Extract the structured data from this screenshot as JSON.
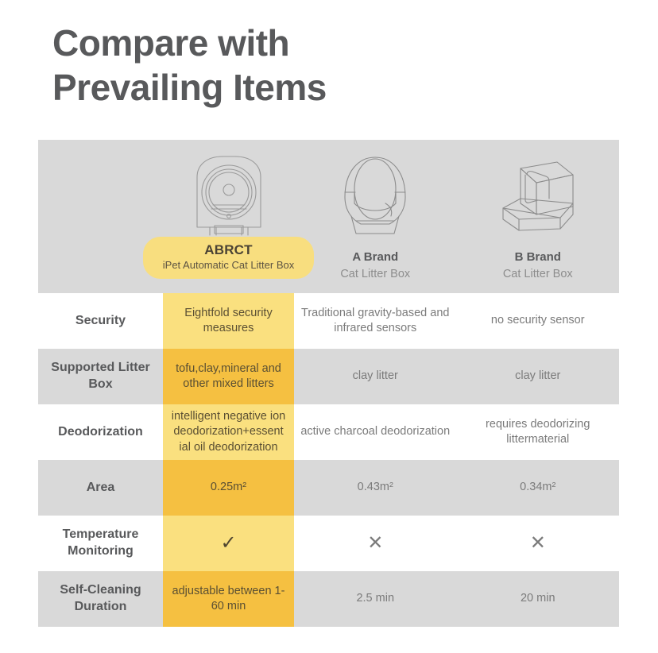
{
  "heading": {
    "line1": "Compare with",
    "line2": "Prevailing Items"
  },
  "colors": {
    "accent_light": "#fae07f",
    "accent_dark": "#f5c041",
    "badge": "#f8de7f",
    "row_alt": "#d9d9d9",
    "header_band": "#d9d9d9",
    "heading_text": "#58595b",
    "rival_text": "#7b7b7b"
  },
  "products": [
    {
      "name": "ABRCT",
      "subtitle": "iPet Automatic Cat Litter Box",
      "highlighted": true,
      "icon": "automatic-cat-litter-box-illustration"
    },
    {
      "name": "A Brand",
      "subtitle": "Cat Litter Box",
      "highlighted": false,
      "icon": "globe-cat-litter-box-illustration"
    },
    {
      "name": "B Brand",
      "subtitle": "Cat Litter Box",
      "highlighted": false,
      "icon": "hooded-cat-litter-box-illustration"
    }
  ],
  "rows": [
    {
      "label": "Security",
      "abrct": "Eightfold security measures",
      "brand_a": "Traditional gravity-based and infrared sensors",
      "brand_b": "no security sensor"
    },
    {
      "label": "Supported Litter Box",
      "abrct": "tofu,clay,mineral and other mixed litters",
      "brand_a": "clay litter",
      "brand_b": "clay litter"
    },
    {
      "label": "Deodorization",
      "abrct": "intelligent negative ion deodorization+essent ial oil deodorization",
      "brand_a": "active charcoal deodorization",
      "brand_b": "requires deodorizing littermaterial"
    },
    {
      "label": "Area",
      "abrct": "0.25m²",
      "brand_a": "0.43m²",
      "brand_b": "0.34m²"
    },
    {
      "label": "Temperature Monitoring",
      "abrct": "✓",
      "brand_a": "✕",
      "brand_b": "✕"
    },
    {
      "label": "Self-Cleaning Duration",
      "abrct": "adjustable between 1-60 min",
      "brand_a": "2.5 min",
      "brand_b": "20 min"
    }
  ]
}
